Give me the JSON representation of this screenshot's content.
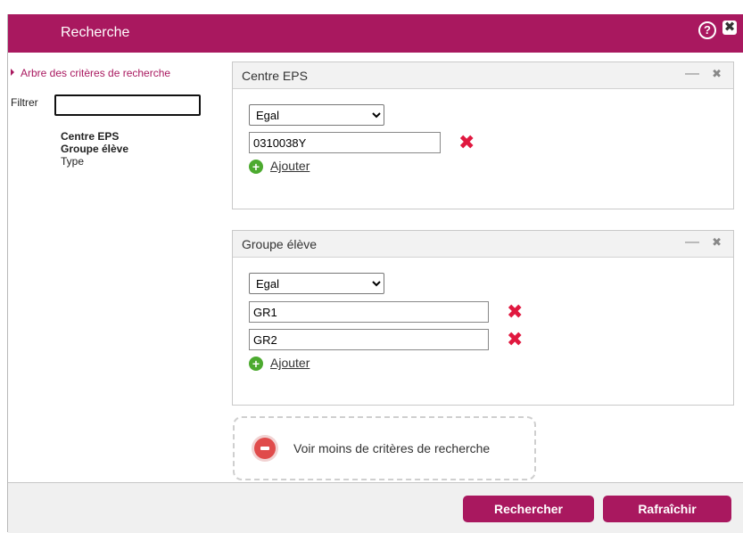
{
  "dialog": {
    "title": "Recherche",
    "help_glyph": "?",
    "close_glyph": "✖",
    "help_icon": "help-circle-icon",
    "close_icon": "close-icon"
  },
  "sidebar": {
    "tree_link": "Arbre des critères de recherche",
    "filter_label": "Filtrer",
    "filter_value": "",
    "items": [
      {
        "label": "Centre EPS",
        "bold": true
      },
      {
        "label": "Groupe élève",
        "bold": true
      },
      {
        "label": "Type",
        "bold": false
      }
    ]
  },
  "panels": [
    {
      "title": "Centre EPS",
      "minimize_glyph": "—",
      "close_glyph": "✖",
      "operator": "Egal",
      "operator_options": [
        "Egal"
      ],
      "values": [
        "0310038Y"
      ],
      "add_label": "Ajouter"
    },
    {
      "title": "Groupe élève",
      "minimize_glyph": "—",
      "close_glyph": "✖",
      "operator": "Egal",
      "operator_options": [
        "Egal"
      ],
      "values": [
        "GR1",
        "GR2"
      ],
      "add_label": "Ajouter"
    }
  ],
  "remove_glyph": "✖",
  "add_glyph": "+",
  "fewer_criteria_label": "Voir moins de critères de recherche",
  "footer": {
    "search_label": "Rechercher",
    "refresh_label": "Rafraîchir"
  },
  "colors": {
    "brand": "#a9185f",
    "remove": "#e0183f",
    "add": "#4caa2f"
  }
}
